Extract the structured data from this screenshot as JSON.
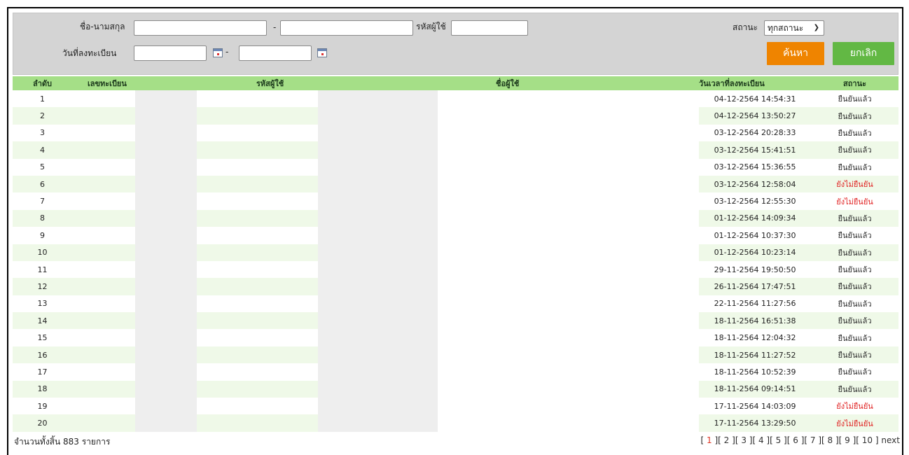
{
  "filter": {
    "name_label": "ชื่อ-นามสกุล",
    "dash": "-",
    "userid_label": "รหัสผู้ใช้",
    "regdate_label": "วันที่ลงทะเบียน",
    "status_label": "สถานะ",
    "status_selected": "ทุกสถานะ",
    "search_label": "ค้นหา",
    "cancel_label": "ยกเลิก"
  },
  "table": {
    "headers": [
      "ลำดับ",
      "เลขทะเบียน",
      "รหัสผู้ใช้",
      "ชื่อผู้ใช้",
      "วันเวลาที่ลงทะเบียน",
      "สถานะ"
    ],
    "rows": [
      {
        "no": "1",
        "datetime": "04-12-2564 14:54:31",
        "status": "ยืนยันแล้ว",
        "confirmed": true
      },
      {
        "no": "2",
        "datetime": "04-12-2564 13:50:27",
        "status": "ยืนยันแล้ว",
        "confirmed": true
      },
      {
        "no": "3",
        "datetime": "03-12-2564 20:28:33",
        "status": "ยืนยันแล้ว",
        "confirmed": true
      },
      {
        "no": "4",
        "datetime": "03-12-2564 15:41:51",
        "status": "ยืนยันแล้ว",
        "confirmed": true
      },
      {
        "no": "5",
        "datetime": "03-12-2564 15:36:55",
        "status": "ยืนยันแล้ว",
        "confirmed": true
      },
      {
        "no": "6",
        "datetime": "03-12-2564 12:58:04",
        "status": "ยังไม่ยืนยัน",
        "confirmed": false
      },
      {
        "no": "7",
        "datetime": "03-12-2564 12:55:30",
        "status": "ยังไม่ยืนยัน",
        "confirmed": false
      },
      {
        "no": "8",
        "datetime": "01-12-2564 14:09:34",
        "status": "ยืนยันแล้ว",
        "confirmed": true
      },
      {
        "no": "9",
        "datetime": "01-12-2564 10:37:30",
        "status": "ยืนยันแล้ว",
        "confirmed": true
      },
      {
        "no": "10",
        "datetime": "01-12-2564 10:23:14",
        "status": "ยืนยันแล้ว",
        "confirmed": true
      },
      {
        "no": "11",
        "datetime": "29-11-2564 19:50:50",
        "status": "ยืนยันแล้ว",
        "confirmed": true
      },
      {
        "no": "12",
        "datetime": "26-11-2564 17:47:51",
        "status": "ยืนยันแล้ว",
        "confirmed": true
      },
      {
        "no": "13",
        "datetime": "22-11-2564 11:27:56",
        "status": "ยืนยันแล้ว",
        "confirmed": true
      },
      {
        "no": "14",
        "datetime": "18-11-2564 16:51:38",
        "status": "ยืนยันแล้ว",
        "confirmed": true
      },
      {
        "no": "15",
        "datetime": "18-11-2564 12:04:32",
        "status": "ยืนยันแล้ว",
        "confirmed": true
      },
      {
        "no": "16",
        "datetime": "18-11-2564 11:27:52",
        "status": "ยืนยันแล้ว",
        "confirmed": true
      },
      {
        "no": "17",
        "datetime": "18-11-2564 10:52:39",
        "status": "ยืนยันแล้ว",
        "confirmed": true
      },
      {
        "no": "18",
        "datetime": "18-11-2564 09:14:51",
        "status": "ยืนยันแล้ว",
        "confirmed": true
      },
      {
        "no": "19",
        "datetime": "17-11-2564 14:03:09",
        "status": "ยังไม่ยืนยัน",
        "confirmed": false
      },
      {
        "no": "20",
        "datetime": "17-11-2564 13:29:50",
        "status": "ยังไม่ยืนยัน",
        "confirmed": false
      }
    ]
  },
  "footer": {
    "total_text": "จำนวนทั้งสิ้น 883 รายการ",
    "pages": [
      "1",
      "2",
      "3",
      "4",
      "5",
      "6",
      "7",
      "8",
      "9",
      "10"
    ],
    "current_page": "1",
    "next_label": "next"
  },
  "colors": {
    "header_bg": "#a5df87",
    "search_button": "#ef8400",
    "cancel_button": "#62b844",
    "pending_status": "#e02020"
  }
}
